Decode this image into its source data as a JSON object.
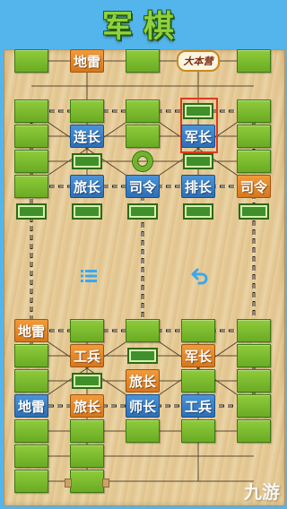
{
  "title": "军棋",
  "headquarters_label": "大本营",
  "watermark": "九游",
  "controls": {
    "list_icon": "list-icon",
    "undo_icon": "undo-icon"
  },
  "colors": {
    "blue_piece": "#2e6fb6",
    "orange_piece": "#d7771d",
    "empty_slot": "#7dbb30",
    "selected": "#e03a1e"
  },
  "pieces": {
    "top_r0_c1": "地雷",
    "top_r2_c1": "连长",
    "top_r2_c3": "军长",
    "top_r4_c1": "旅长",
    "top_r4_c2": "司令",
    "top_r4_c3": "排长",
    "top_r4_c4": "司令",
    "bot_r0_c0": "地雷",
    "bot_r1_c1": "工兵",
    "bot_r1_c3": "军长",
    "bot_r2_c2": "旅长",
    "bot_r3_c0": "地雷",
    "bot_r3_c1": "旅长",
    "bot_r3_c2": "师长",
    "bot_r3_c3": "工兵"
  }
}
